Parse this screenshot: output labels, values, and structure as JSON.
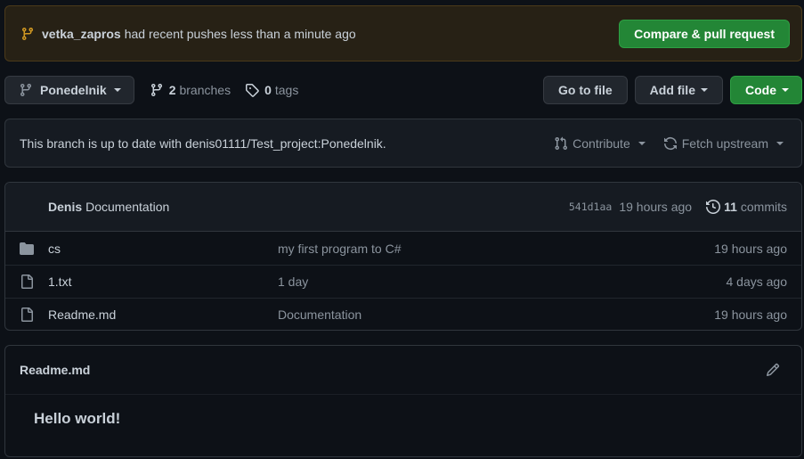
{
  "colors": {
    "background": "#0d1117",
    "banner_bg": "#272115",
    "primary_green": "#238636",
    "muted_text": "#8b949e",
    "text": "#c9d1d9",
    "icon_orange": "#d29922"
  },
  "banner": {
    "branch": "vetka_zapros",
    "message": "had recent pushes less than a minute ago",
    "button_label": "Compare & pull request",
    "icon": "git-branch-icon"
  },
  "toolbar": {
    "branch_selector": "Ponedelnik",
    "branches_count": "2",
    "branches_label": "branches",
    "tags_count": "0",
    "tags_label": "tags",
    "go_to_file": "Go to file",
    "add_file": "Add file",
    "code": "Code"
  },
  "sync": {
    "message": "This branch is up to date with denis01111/Test_project:Ponedelnik.",
    "contribute": "Contribute",
    "fetch_upstream": "Fetch upstream"
  },
  "latest_commit": {
    "author": "Denis",
    "message": "Documentation",
    "sha": "541d1aa",
    "time": "19 hours ago",
    "commits_count": "11",
    "commits_label": "commits"
  },
  "files": [
    {
      "type": "folder",
      "icon": "folder-icon",
      "name": "cs",
      "message": "my first program to C#",
      "time": "19 hours ago"
    },
    {
      "type": "file",
      "icon": "file-icon",
      "name": "1.txt",
      "message": "1 day",
      "time": "4 days ago"
    },
    {
      "type": "file",
      "icon": "file-icon",
      "name": "Readme.md",
      "message": "Documentation",
      "time": "19 hours ago"
    }
  ],
  "readme": {
    "title": "Readme.md",
    "heading": "Hello world!",
    "edit_icon": "pencil-icon"
  }
}
